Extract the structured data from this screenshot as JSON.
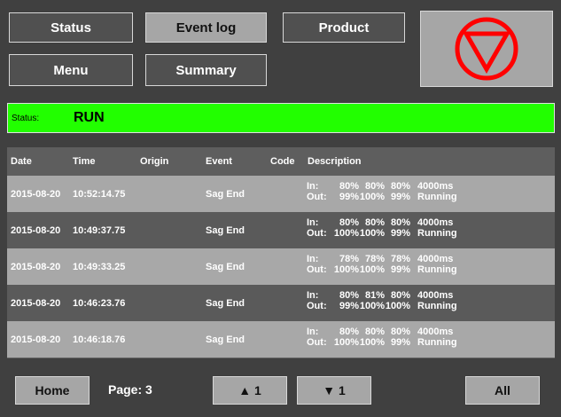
{
  "nav": {
    "status": "Status",
    "event_log": "Event log",
    "product": "Product",
    "menu": "Menu",
    "summary": "Summary",
    "active": "event_log"
  },
  "stop_icon": {
    "name": "stop-triangle-icon",
    "color": "#ff0000"
  },
  "status_bar": {
    "label": "Status:",
    "value": "RUN",
    "color": "#22ff00"
  },
  "table": {
    "headers": {
      "date": "Date",
      "time": "Time",
      "origin": "Origin",
      "event": "Event",
      "code": "Code",
      "description": "Description"
    },
    "rows": [
      {
        "date": "2015-08-20",
        "time": "10:52:14.75",
        "origin": "",
        "event": "Sag End",
        "code": "",
        "in_label": "In:",
        "out_label": "Out:",
        "in": [
          "80%",
          "80%",
          "80%",
          "4000ms"
        ],
        "out": [
          "99%",
          "100%",
          "99%",
          "Running"
        ]
      },
      {
        "date": "2015-08-20",
        "time": "10:49:37.75",
        "origin": "",
        "event": "Sag End",
        "code": "",
        "in_label": "In:",
        "out_label": "Out:",
        "in": [
          "80%",
          "80%",
          "80%",
          "4000ms"
        ],
        "out": [
          "100%",
          "100%",
          "99%",
          "Running"
        ]
      },
      {
        "date": "2015-08-20",
        "time": "10:49:33.25",
        "origin": "",
        "event": "Sag End",
        "code": "",
        "in_label": "In:",
        "out_label": "Out:",
        "in": [
          "78%",
          "78%",
          "78%",
          "4000ms"
        ],
        "out": [
          "100%",
          "100%",
          "99%",
          "Running"
        ]
      },
      {
        "date": "2015-08-20",
        "time": "10:46:23.76",
        "origin": "",
        "event": "Sag End",
        "code": "",
        "in_label": "In:",
        "out_label": "Out:",
        "in": [
          "80%",
          "81%",
          "80%",
          "4000ms"
        ],
        "out": [
          "99%",
          "100%",
          "100%",
          "Running"
        ]
      },
      {
        "date": "2015-08-20",
        "time": "10:46:18.76",
        "origin": "",
        "event": "Sag End",
        "code": "",
        "in_label": "In:",
        "out_label": "Out:",
        "in": [
          "80%",
          "80%",
          "80%",
          "4000ms"
        ],
        "out": [
          "100%",
          "100%",
          "99%",
          "Running"
        ]
      }
    ]
  },
  "footer": {
    "home": "Home",
    "page_label": "Page: 3",
    "up": "▲ 1",
    "down": "▼ 1",
    "all": "All"
  }
}
